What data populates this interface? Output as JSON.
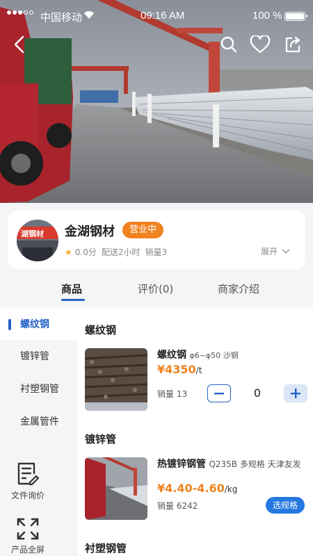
{
  "status_bar": {
    "carrier": "中国移动",
    "time": "09:16 AM",
    "battery": "100 %"
  },
  "shop": {
    "name": "金湖钢材",
    "avatar_text": "湖钢材",
    "status": "营业中",
    "rating": "0.0分",
    "delivery": "配送2小时",
    "sales": "销量3",
    "expand_label": "展开"
  },
  "tabs": [
    {
      "label": "商品"
    },
    {
      "label": "评价(0)"
    },
    {
      "label": "商家介绍"
    }
  ],
  "categories": [
    {
      "label": "螺纹钢"
    },
    {
      "label": "镀锌管"
    },
    {
      "label": "衬塑钢管"
    },
    {
      "label": "金属管件"
    }
  ],
  "side_tools": {
    "file_inquiry": "文件询价",
    "fullscreen": "产品全屏"
  },
  "sections": [
    {
      "title": "螺纹钢",
      "product": {
        "name": "螺纹钢",
        "spec": "φ6~φ50  沙钢",
        "price": "¥4350",
        "unit": "/t",
        "sales": "销量 13",
        "quantity": "0"
      }
    },
    {
      "title": "镀锌管",
      "product": {
        "name": "热镀锌钢管",
        "spec": "Q235B  多规格  天津友发",
        "price": "¥4.40-4.60",
        "unit": "/kg",
        "sales": "销量 6242",
        "action": "选规格"
      }
    },
    {
      "title": "衬塑钢管"
    }
  ],
  "colors": {
    "accent_blue": "#2463c7",
    "accent_orange": "#f08320"
  }
}
